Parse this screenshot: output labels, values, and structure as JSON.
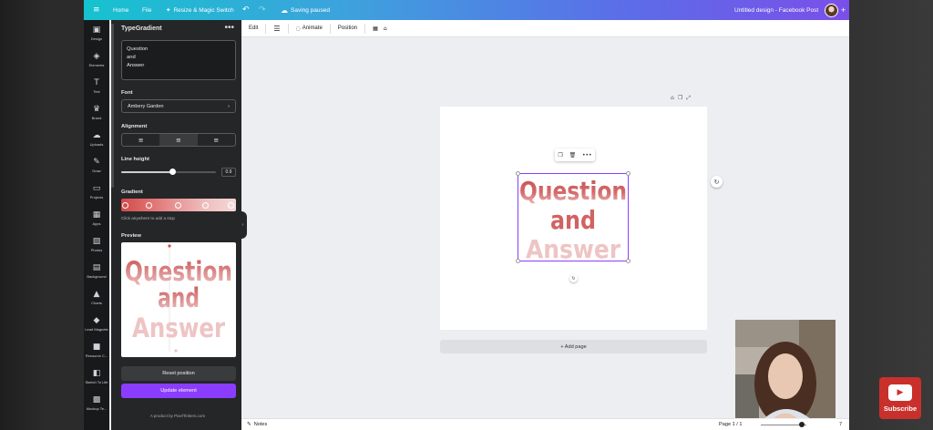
{
  "topbar": {
    "menu_icon": "hamburger-icon",
    "home": "Home",
    "file": "File",
    "resize": "Resize & Magic Switch",
    "saving": "Saving paused",
    "design_title": "Untitled design - Facebook Post"
  },
  "rail": {
    "items": [
      {
        "label": "Design",
        "icon": "design-icon"
      },
      {
        "label": "Elements",
        "icon": "elements-icon"
      },
      {
        "label": "Text",
        "icon": "text-icon"
      },
      {
        "label": "Brand",
        "icon": "brand-icon"
      },
      {
        "label": "Uploads",
        "icon": "uploads-icon"
      },
      {
        "label": "Draw",
        "icon": "draw-icon"
      },
      {
        "label": "Projects",
        "icon": "projects-icon"
      },
      {
        "label": "Apps",
        "icon": "apps-icon"
      },
      {
        "label": "Photos",
        "icon": "photos-icon"
      },
      {
        "label": "Background",
        "icon": "background-icon"
      },
      {
        "label": "Charts",
        "icon": "charts-icon"
      },
      {
        "label": "Lead Magnets",
        "icon": "lead-magnets-icon"
      },
      {
        "label": "Resource C...",
        "icon": "resource-icon"
      },
      {
        "label": "Sketch To Life",
        "icon": "sketch-icon"
      },
      {
        "label": "Mockup Te...",
        "icon": "mockup-icon"
      }
    ]
  },
  "panel": {
    "title": "TypeGradient",
    "text_lines": [
      "Question",
      "and",
      "Answer"
    ],
    "font_label": "Font",
    "font_value": "Ambery Garden",
    "alignment_label": "Alignment",
    "line_height_label": "Line height",
    "line_height_value": "0.9",
    "gradient_label": "Gradient",
    "gradient_hint": "Click anywhere to add a stop",
    "gradient_colors": [
      "#d24a4a",
      "#e07070",
      "#e89a9a",
      "#f0c0c0",
      "#f4d8d8"
    ],
    "preview_label": "Preview",
    "preview_lines": [
      "Question",
      "and",
      "Answer"
    ],
    "reset_button": "Reset position",
    "update_button": "Update element",
    "credit": "A product by PixelTinkers.com"
  },
  "toolbar": {
    "edit": "Edit",
    "animate": "Animate",
    "position": "Position"
  },
  "design": {
    "lines": [
      "Question",
      "and",
      "Answer"
    ],
    "add_page": "+ Add page"
  },
  "bottombar": {
    "notes": "Notes",
    "page_indicator": "Page 1 / 1",
    "zoom_value": "7"
  },
  "overlay": {
    "subscribe": "Subscribe"
  },
  "colors": {
    "accent": "#8b3dff",
    "text_gradient_top": "#c85050",
    "text_gradient_bottom": "#eec4c4"
  }
}
